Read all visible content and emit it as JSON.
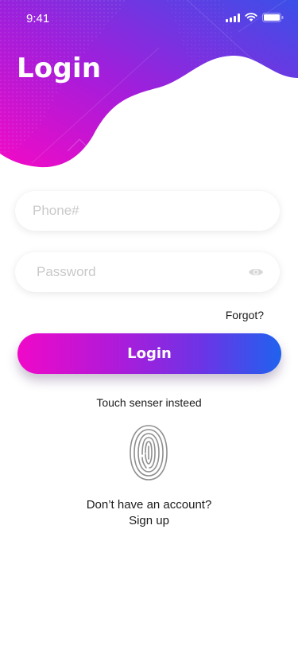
{
  "status_bar": {
    "time": "9:41",
    "signal_icon": "cellular-signal-icon",
    "wifi_icon": "wifi-icon",
    "battery_icon": "battery-icon"
  },
  "header": {
    "title": "Login",
    "gradient_start": "#f20ac6",
    "gradient_end": "#3b4fe8"
  },
  "form": {
    "phone": {
      "placeholder": "Phone#",
      "value": ""
    },
    "password": {
      "placeholder": "Password",
      "value": "",
      "toggle_icon": "eye-icon"
    },
    "forgot_label": "Forgot?",
    "login_button_label": "Login"
  },
  "biometric": {
    "label": "Touch senser insteed",
    "icon": "fingerprint-icon"
  },
  "footer": {
    "prompt": "Don’t have an account?",
    "signup_label": "Sign up"
  },
  "colors": {
    "accent_pink": "#f008c8",
    "accent_blue": "#1f62ee",
    "text": "#1b1b1b",
    "placeholder": "#c9c9c9"
  }
}
